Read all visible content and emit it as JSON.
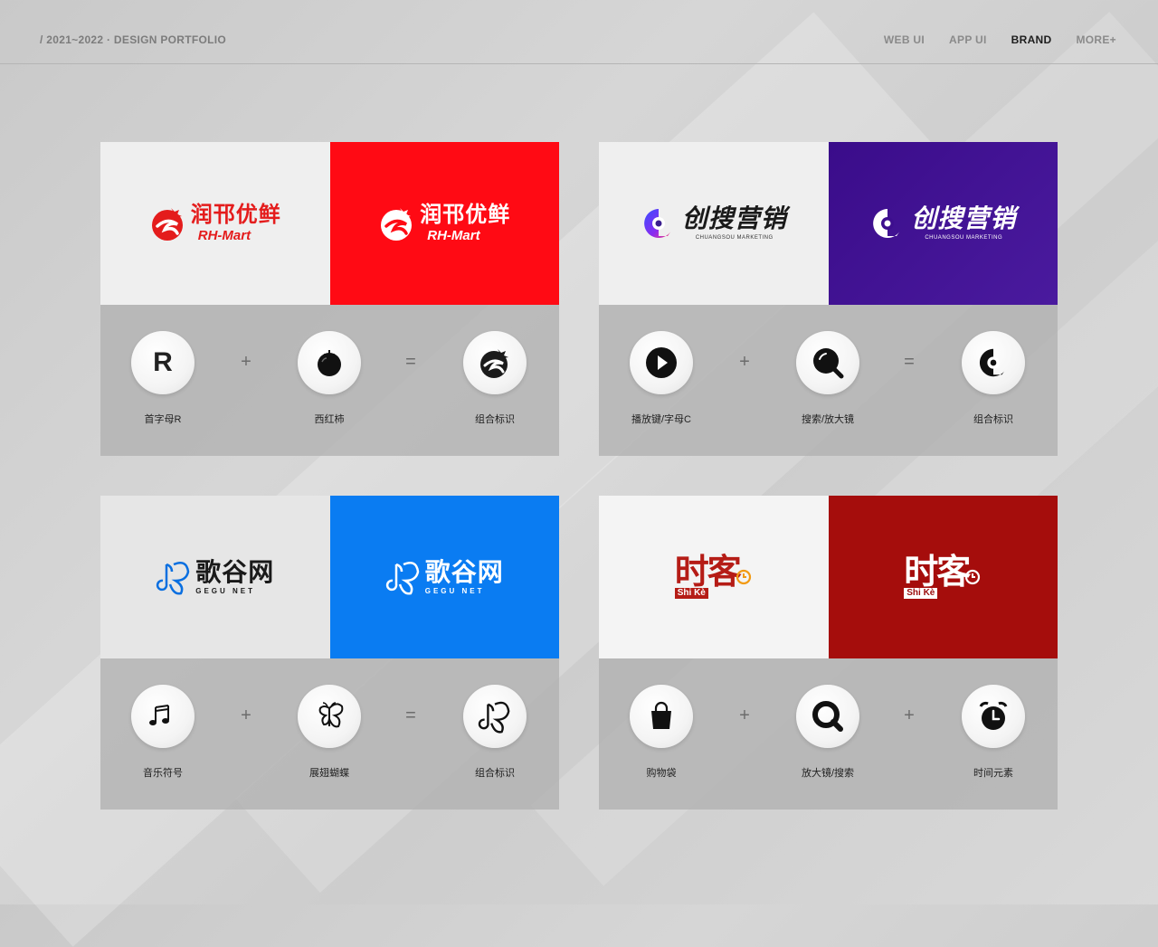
{
  "header": {
    "breadcrumb": "/ 2021~2022 · DESIGN PORTFOLIO",
    "nav": [
      {
        "label": "WEB UI",
        "active": false
      },
      {
        "label": "APP UI",
        "active": false
      },
      {
        "label": "BRAND",
        "active": true
      },
      {
        "label": "MORE+",
        "active": false
      }
    ]
  },
  "cards": [
    {
      "logo_cn": "润邗优鲜",
      "logo_en": "RH-Mart",
      "accent": "#ff0a14",
      "operators": [
        "+",
        "="
      ],
      "elements": [
        {
          "icon": "letter-r-icon",
          "text": "R",
          "caption": "首字母R"
        },
        {
          "icon": "tomato-icon",
          "caption": "西红柿"
        },
        {
          "icon": "rh-mark-icon",
          "caption": "组合标识"
        }
      ]
    },
    {
      "logo_cn": "创搜营销",
      "logo_en": "CHUANGSOU MARKETING",
      "accent": "#3d0e8e",
      "operators": [
        "+",
        "="
      ],
      "elements": [
        {
          "icon": "play-button-icon",
          "caption": "播放键/字母C"
        },
        {
          "icon": "magnifier-icon",
          "caption": "搜索/放大镜"
        },
        {
          "icon": "cs-mark-icon",
          "caption": "组合标识"
        }
      ]
    },
    {
      "logo_cn": "歌谷网",
      "logo_en": "GEGU NET",
      "accent": "#0a7cf2",
      "operators": [
        "+",
        "="
      ],
      "elements": [
        {
          "icon": "music-note-icon",
          "caption": "音乐符号"
        },
        {
          "icon": "butterfly-icon",
          "caption": "展翅蝴蝶"
        },
        {
          "icon": "gg-mark-icon",
          "caption": "组合标识"
        }
      ]
    },
    {
      "logo_cn": "时客",
      "logo_en": "Shi Kè",
      "accent": "#a50d0c",
      "operators": [
        "+",
        "+"
      ],
      "elements": [
        {
          "icon": "shopping-bag-icon",
          "caption": "购物袋"
        },
        {
          "icon": "magnifier-icon",
          "caption": "放大镜/搜索"
        },
        {
          "icon": "alarm-clock-icon",
          "caption": "时间元素"
        }
      ]
    }
  ]
}
